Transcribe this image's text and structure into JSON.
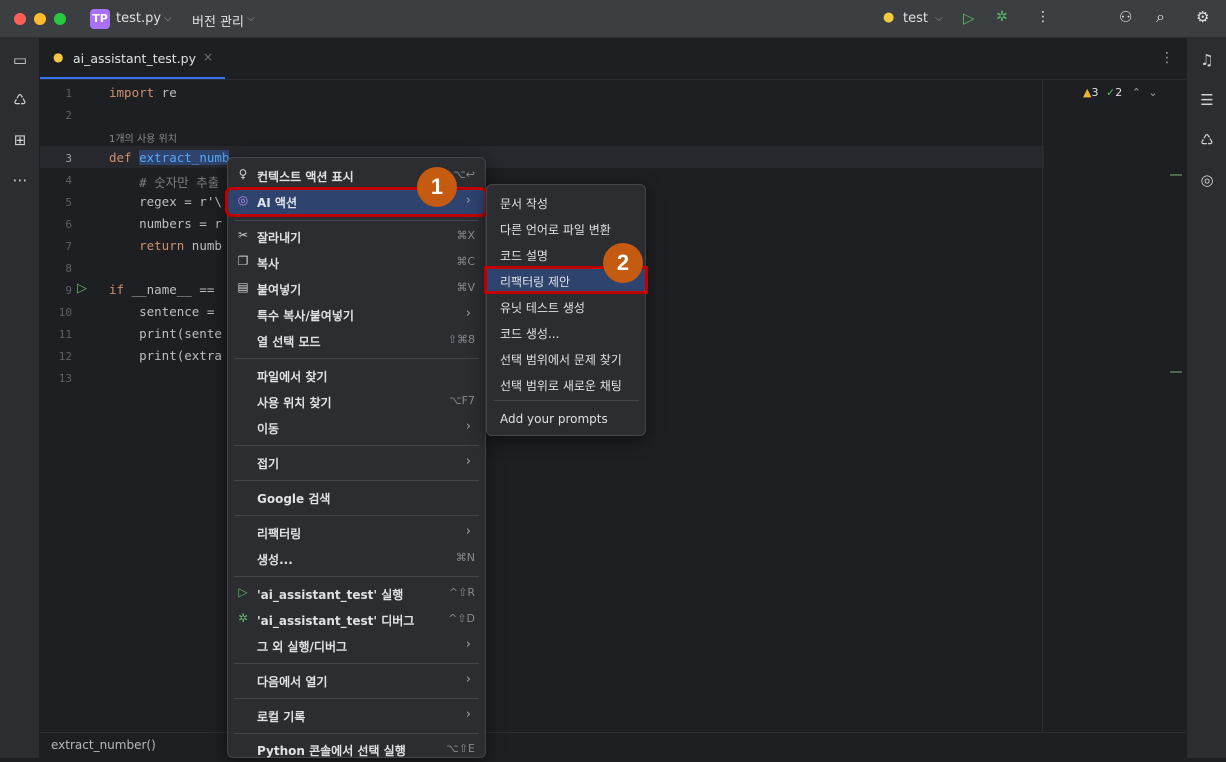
{
  "titlebar": {
    "project_badge": "TP",
    "project_name": "test.py",
    "vcs_label": "버전 관리",
    "run_config": "test"
  },
  "tab": {
    "filename": "ai_assistant_test.py"
  },
  "editor": {
    "usage_hint": "1개의 사용 위치",
    "inspection_warnings": "3",
    "inspection_checks": "2",
    "line_numbers": [
      "1",
      "2",
      "3",
      "4",
      "5",
      "6",
      "7",
      "8",
      "9",
      "10",
      "11",
      "12",
      "13"
    ]
  },
  "code": {
    "l1_kw": "import",
    "l1_rest": " re",
    "l3_kw": "def",
    "l3_fn": "extract_numb",
    "l4": "    # 숫자만 추출",
    "l5": "    regex = r'\\",
    "l6": "    numbers = r",
    "l7_kw": "    return",
    "l7_rest": " numb",
    "l9_kw": "if",
    "l9_rest": " __name__ ==",
    "l10": "    sentence =",
    "l11": "    print(sente",
    "l12": "    print(extra"
  },
  "status": {
    "breadcrumb": "extract_number()"
  },
  "context_menu": {
    "show_context_actions": "컨텍스트 액션 표시",
    "ai_actions": "AI 액션",
    "cut": "잘라내기",
    "cut_sc": "⌘X",
    "copy": "복사",
    "copy_sc": "⌘C",
    "paste": "붙여넣기",
    "paste_sc": "⌘V",
    "special_copy_paste": "특수 복사/붙여넣기",
    "column_select": "열 선택 모드",
    "column_select_sc": "⇧⌘8",
    "find_in_files": "파일에서 찾기",
    "find_usages": "사용 위치 찾기",
    "find_usages_sc": "⌥F7",
    "go_to": "이동",
    "folding": "접기",
    "google_search": "Google 검색",
    "refactor": "리팩터링",
    "generate": "생성...",
    "generate_sc": "⌘N",
    "run": "'ai_assistant_test' 실행",
    "run_sc": "^⇧R",
    "debug": "'ai_assistant_test' 디버그",
    "debug_sc": "^⇧D",
    "more_run_debug": "그 외 실행/디버그",
    "open_in": "다음에서 열기",
    "local_history": "로컬 기록",
    "python_console": "Python 콘솔에서 선택 실행",
    "python_console_sc": "⌥⇧E"
  },
  "ai_submenu": {
    "items": [
      "문서 작성",
      "다른 언어로 파일 변환",
      "코드 설명",
      "리팩터링 제안",
      "유닛 테스트 생성",
      "코드 생성...",
      "선택 범위에서 문제 찾기",
      "선택 범위로 새로운 채팅"
    ],
    "add_prompts": "Add your prompts"
  },
  "annotations": {
    "step1": "1",
    "step2": "2"
  },
  "colors": {
    "highlight_red": "#c00000",
    "badge_orange": "#c55a11",
    "selection_blue": "#2e436e"
  }
}
